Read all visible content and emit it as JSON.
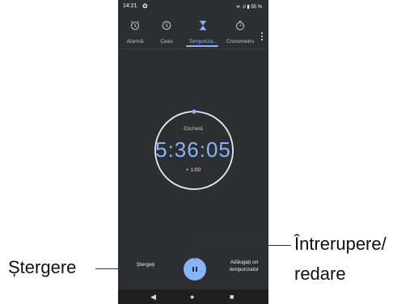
{
  "status_bar": {
    "time": "14:21",
    "battery": "55 %",
    "icons": [
      "gear-icon",
      "wifi-icon",
      "signal-icon",
      "battery-icon"
    ]
  },
  "tabs": [
    {
      "label": "Alarmă",
      "icon": "alarm-icon",
      "active": false
    },
    {
      "label": "Ceas",
      "icon": "clock-icon",
      "active": false
    },
    {
      "label": "Temporiza...",
      "icon": "hourglass-icon",
      "active": true
    },
    {
      "label": "Cronometru",
      "icon": "stopwatch-icon",
      "active": false
    }
  ],
  "timer": {
    "label": "Etichetă",
    "value": "5:36:05",
    "add_time": "+ 1:00"
  },
  "bottom": {
    "delete_label": "Ștergeți",
    "add_timer_label": "Adăugați un temporizator",
    "pause_icon": "pause-icon"
  },
  "callouts": {
    "left": "Ștergere",
    "right_line1": "Întrerupere/",
    "right_line2": "redare"
  },
  "colors": {
    "accent": "#8ab4f8",
    "background": "#2d2e31",
    "text": "#e8eaed"
  }
}
